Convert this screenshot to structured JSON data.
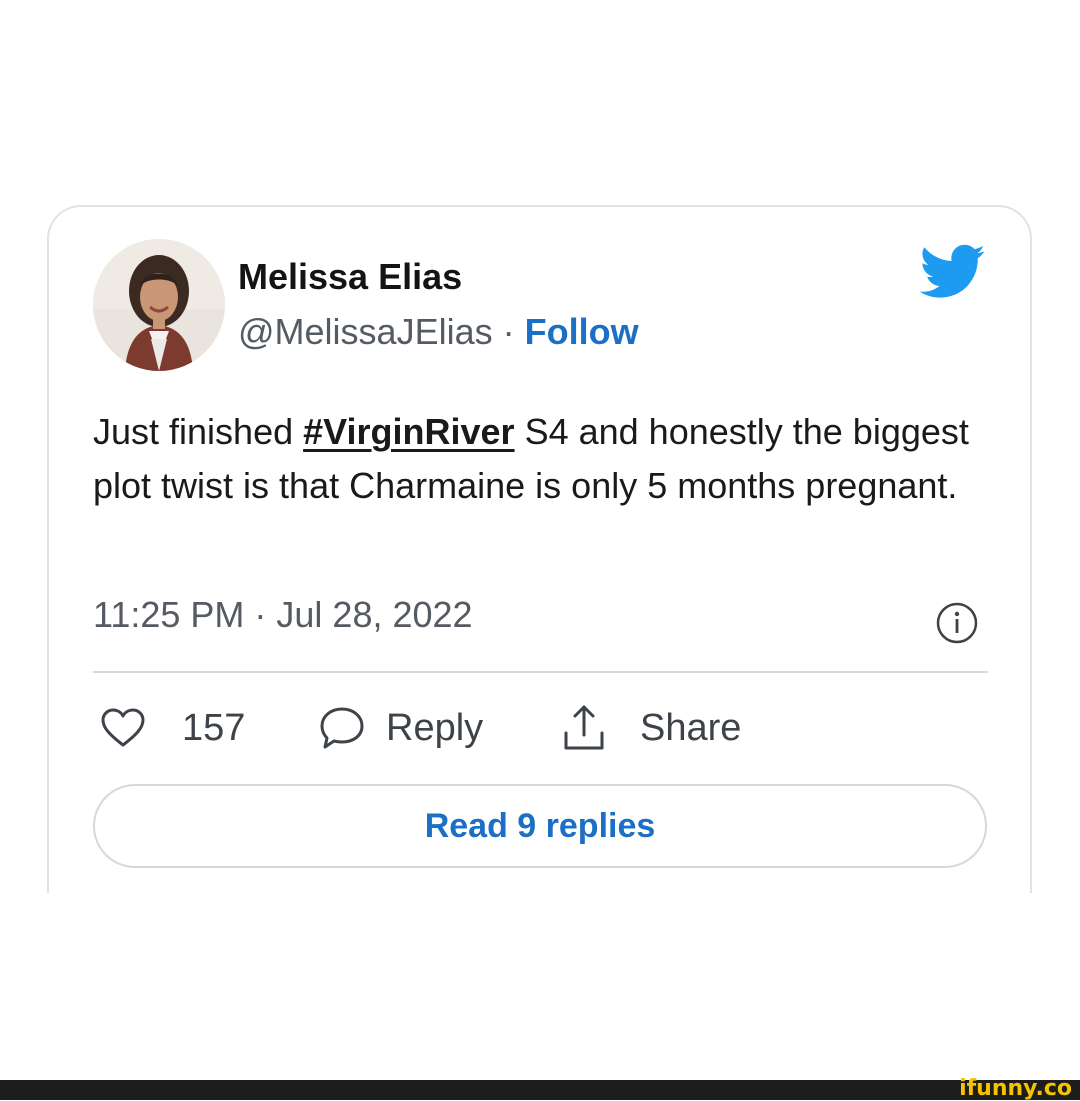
{
  "tweet": {
    "author_name": "Melissa Elias",
    "handle": "@MelissaJElias",
    "separator": " · ",
    "follow_label": "Follow",
    "text_before": "Just finished ",
    "hashtag": "#VirginRiver",
    "text_after": " S4 and honestly the biggest plot twist is that Charmaine is only 5 months pregnant.",
    "timestamp": "11:25 PM · Jul 28, 2022"
  },
  "actions": {
    "like_count": "157",
    "reply_label": "Reply",
    "share_label": "Share",
    "read_replies_label": "Read 9 replies"
  },
  "icons": {
    "brand": "twitter-bird-icon",
    "info": "info-icon",
    "like": "heart-icon",
    "reply": "speech-bubble-icon",
    "share": "share-upload-icon"
  },
  "colors": {
    "link_blue": "#1c6fc5",
    "twitter_blue": "#1d9bf0",
    "secondary_text": "#555b62",
    "border": "#dfe3e8"
  },
  "watermark": "ifunny.co"
}
